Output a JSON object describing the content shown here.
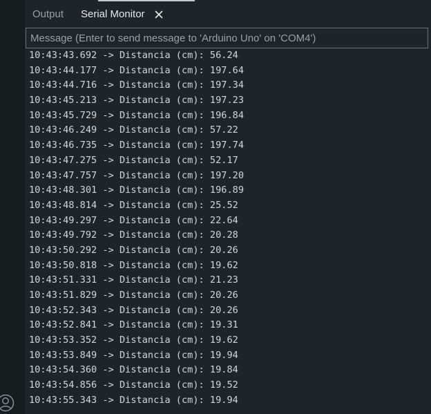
{
  "tabs": {
    "output_label": "Output",
    "serial_label": "Serial Monitor"
  },
  "message_input": {
    "placeholder": "Message (Enter to send message to 'Arduino Uno' on 'COM4')"
  },
  "log": {
    "separator": " -> ",
    "label": "Distancia (cm): ",
    "lines": [
      {
        "time": "10:43:43.692",
        "value": "56.24"
      },
      {
        "time": "10:43:44.177",
        "value": "197.64"
      },
      {
        "time": "10:43:44.716",
        "value": "197.34"
      },
      {
        "time": "10:43:45.213",
        "value": "197.23"
      },
      {
        "time": "10:43:45.729",
        "value": "196.84"
      },
      {
        "time": "10:43:46.249",
        "value": "57.22"
      },
      {
        "time": "10:43:46.735",
        "value": "197.74"
      },
      {
        "time": "10:43:47.275",
        "value": "52.17"
      },
      {
        "time": "10:43:47.757",
        "value": "197.20"
      },
      {
        "time": "10:43:48.301",
        "value": "196.89"
      },
      {
        "time": "10:43:48.814",
        "value": "25.52"
      },
      {
        "time": "10:43:49.297",
        "value": "22.64"
      },
      {
        "time": "10:43:49.792",
        "value": "20.28"
      },
      {
        "time": "10:43:50.292",
        "value": "20.26"
      },
      {
        "time": "10:43:50.818",
        "value": "19.62"
      },
      {
        "time": "10:43:51.331",
        "value": "21.23"
      },
      {
        "time": "10:43:51.829",
        "value": "20.26"
      },
      {
        "time": "10:43:52.343",
        "value": "20.26"
      },
      {
        "time": "10:43:52.841",
        "value": "19.31"
      },
      {
        "time": "10:43:53.352",
        "value": "19.62"
      },
      {
        "time": "10:43:53.849",
        "value": "19.94"
      },
      {
        "time": "10:43:54.360",
        "value": "19.84"
      },
      {
        "time": "10:43:54.856",
        "value": "19.52"
      },
      {
        "time": "10:43:55.343",
        "value": "19.94"
      }
    ]
  },
  "icons": {
    "close": "close-icon",
    "account": "account-icon"
  },
  "colors": {
    "background": "#1f2428",
    "activity_bar": "#171c1f",
    "text": "#d4d7da",
    "muted_text": "#9aa0a6",
    "input_border": "#6b7075"
  }
}
